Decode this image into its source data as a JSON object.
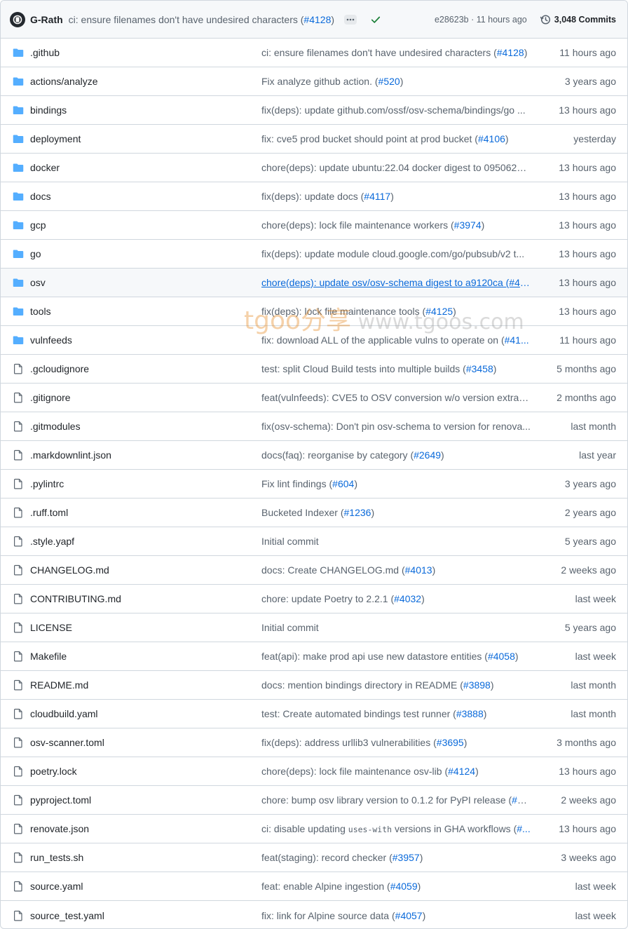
{
  "header": {
    "author": "G-Rath",
    "message": "ci: ensure filenames don't have undesired characters (",
    "message_pr": "#4128",
    "message_tail": ")",
    "sha_time": "e28623b · 11 hours ago",
    "commits": "3,048 Commits"
  },
  "watermark": {
    "brand": "tgoo分享",
    "site": " www.tgoos.com"
  },
  "rows": [
    {
      "type": "dir",
      "name": ".github",
      "msg": "ci: ensure filenames don't have undesired characters (",
      "pr": "#4128",
      "tail": ")",
      "time": "11 hours ago"
    },
    {
      "type": "dir",
      "name": "actions/analyze",
      "msg": "Fix analyze github action. (",
      "pr": "#520",
      "tail": ")",
      "time": "3 years ago"
    },
    {
      "type": "dir",
      "name": "bindings",
      "msg": "fix(deps): update github.com/ossf/osv-schema/bindings/go ...",
      "pr": "",
      "tail": "",
      "time": "13 hours ago"
    },
    {
      "type": "dir",
      "name": "deployment",
      "msg": "fix: cve5 prod bucket should point at prod bucket (",
      "pr": "#4106",
      "tail": ")",
      "time": "yesterday"
    },
    {
      "type": "dir",
      "name": "docker",
      "msg": "chore(deps): update ubuntu:22.04 docker digest to 0950623 ...",
      "pr": "",
      "tail": "",
      "time": "13 hours ago"
    },
    {
      "type": "dir",
      "name": "docs",
      "msg": "fix(deps): update docs (",
      "pr": "#4117",
      "tail": ")",
      "time": "13 hours ago"
    },
    {
      "type": "dir",
      "name": "gcp",
      "msg": "chore(deps): lock file maintenance workers (",
      "pr": "#3974",
      "tail": ")",
      "time": "13 hours ago"
    },
    {
      "type": "dir",
      "name": "go",
      "msg": "fix(deps): update module cloud.google.com/go/pubsub/v2 t...",
      "pr": "",
      "tail": "",
      "time": "13 hours ago"
    },
    {
      "type": "dir",
      "name": "osv",
      "msg": "chore(deps): update osv/osv-schema digest to a9120ca (#41...",
      "pr": "",
      "tail": "",
      "time": "13 hours ago",
      "hover": true
    },
    {
      "type": "dir",
      "name": "tools",
      "msg": "fix(deps): lock file maintenance tools (",
      "pr": "#4125",
      "tail": ")",
      "time": "13 hours ago"
    },
    {
      "type": "dir",
      "name": "vulnfeeds",
      "msg": "fix: download ALL of the applicable vulns to operate on (",
      "pr": "#41...",
      "tail": "",
      "time": "11 hours ago"
    },
    {
      "type": "file",
      "name": ".gcloudignore",
      "msg": "test: split Cloud Build tests into multiple builds (",
      "pr": "#3458",
      "tail": ")",
      "time": "5 months ago"
    },
    {
      "type": "file",
      "name": ".gitignore",
      "msg": "feat(vulnfeeds): CVE5 to OSV conversion w/o version extracti...",
      "pr": "",
      "tail": "",
      "time": "2 months ago"
    },
    {
      "type": "file",
      "name": ".gitmodules",
      "msg": "fix(osv-schema): Don't pin osv-schema to version for renova...",
      "pr": "",
      "tail": "",
      "time": "last month"
    },
    {
      "type": "file",
      "name": ".markdownlint.json",
      "msg": "docs(faq): reorganise by category (",
      "pr": "#2649",
      "tail": ")",
      "time": "last year"
    },
    {
      "type": "file",
      "name": ".pylintrc",
      "msg": "Fix lint findings (",
      "pr": "#604",
      "tail": ")",
      "time": "3 years ago"
    },
    {
      "type": "file",
      "name": ".ruff.toml",
      "msg": "Bucketed Indexer (",
      "pr": "#1236",
      "tail": ")",
      "time": "2 years ago"
    },
    {
      "type": "file",
      "name": ".style.yapf",
      "msg": "Initial commit",
      "pr": "",
      "tail": "",
      "time": "5 years ago"
    },
    {
      "type": "file",
      "name": "CHANGELOG.md",
      "msg": "docs: Create CHANGELOG.md (",
      "pr": "#4013",
      "tail": ")",
      "time": "2 weeks ago"
    },
    {
      "type": "file",
      "name": "CONTRIBUTING.md",
      "msg": "chore: update Poetry to 2.2.1 (",
      "pr": "#4032",
      "tail": ")",
      "time": "last week"
    },
    {
      "type": "file",
      "name": "LICENSE",
      "msg": "Initial commit",
      "pr": "",
      "tail": "",
      "time": "5 years ago"
    },
    {
      "type": "file",
      "name": "Makefile",
      "msg": "feat(api): make prod api use new datastore entities (",
      "pr": "#4058",
      "tail": ")",
      "time": "last week"
    },
    {
      "type": "file",
      "name": "README.md",
      "msg": "docs: mention bindings directory in README (",
      "pr": "#3898",
      "tail": ")",
      "time": "last month"
    },
    {
      "type": "file",
      "name": "cloudbuild.yaml",
      "msg": "test: Create automated bindings test runner (",
      "pr": "#3888",
      "tail": ")",
      "time": "last month"
    },
    {
      "type": "file",
      "name": "osv-scanner.toml",
      "msg": "fix(deps): address urllib3 vulnerabilities (",
      "pr": "#3695",
      "tail": ")",
      "time": "3 months ago"
    },
    {
      "type": "file",
      "name": "poetry.lock",
      "msg": "chore(deps): lock file maintenance osv-lib (",
      "pr": "#4124",
      "tail": ")",
      "time": "13 hours ago"
    },
    {
      "type": "file",
      "name": "pyproject.toml",
      "msg": "chore: bump osv library version to 0.1.2 for PyPI release (",
      "pr": "#40...",
      "tail": "",
      "time": "2 weeks ago"
    },
    {
      "type": "file",
      "name": "renovate.json",
      "msg": "ci: disable updating ",
      "code": "uses-with",
      "msg2": " versions in GHA workflows (",
      "pr": "#...",
      "tail": "",
      "time": "13 hours ago"
    },
    {
      "type": "file",
      "name": "run_tests.sh",
      "msg": "feat(staging): record checker (",
      "pr": "#3957",
      "tail": ")",
      "time": "3 weeks ago"
    },
    {
      "type": "file",
      "name": "source.yaml",
      "msg": "feat: enable Alpine ingestion (",
      "pr": "#4059",
      "tail": ")",
      "time": "last week"
    },
    {
      "type": "file",
      "name": "source_test.yaml",
      "msg": "fix: link for Alpine source data (",
      "pr": "#4057",
      "tail": ")",
      "time": "last week"
    }
  ]
}
